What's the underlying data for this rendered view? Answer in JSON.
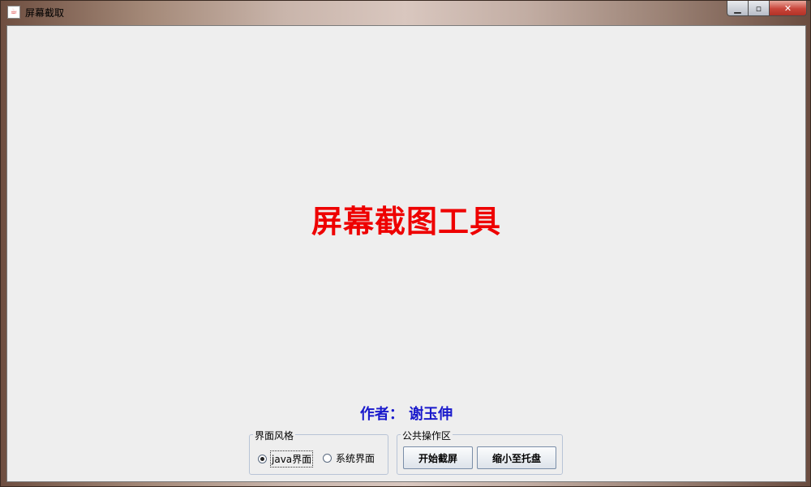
{
  "window": {
    "title": "屏幕截取",
    "icon": "java-app-icon",
    "controls": {
      "minimize": "minimize-icon",
      "maximize": "maximize-icon",
      "close": "close-icon"
    }
  },
  "main": {
    "title": "屏幕截图工具",
    "author": "作者： 谢玉伸"
  },
  "style_group": {
    "title": "界面风格",
    "options": [
      {
        "label": "java界面",
        "selected": true
      },
      {
        "label": "系统界面",
        "selected": false
      }
    ]
  },
  "ops_group": {
    "title": "公共操作区",
    "start_label": "开始截屏",
    "tray_label": "缩小至托盘"
  },
  "colors": {
    "title_red": "#ee0000",
    "author_blue": "#1a1acc"
  }
}
